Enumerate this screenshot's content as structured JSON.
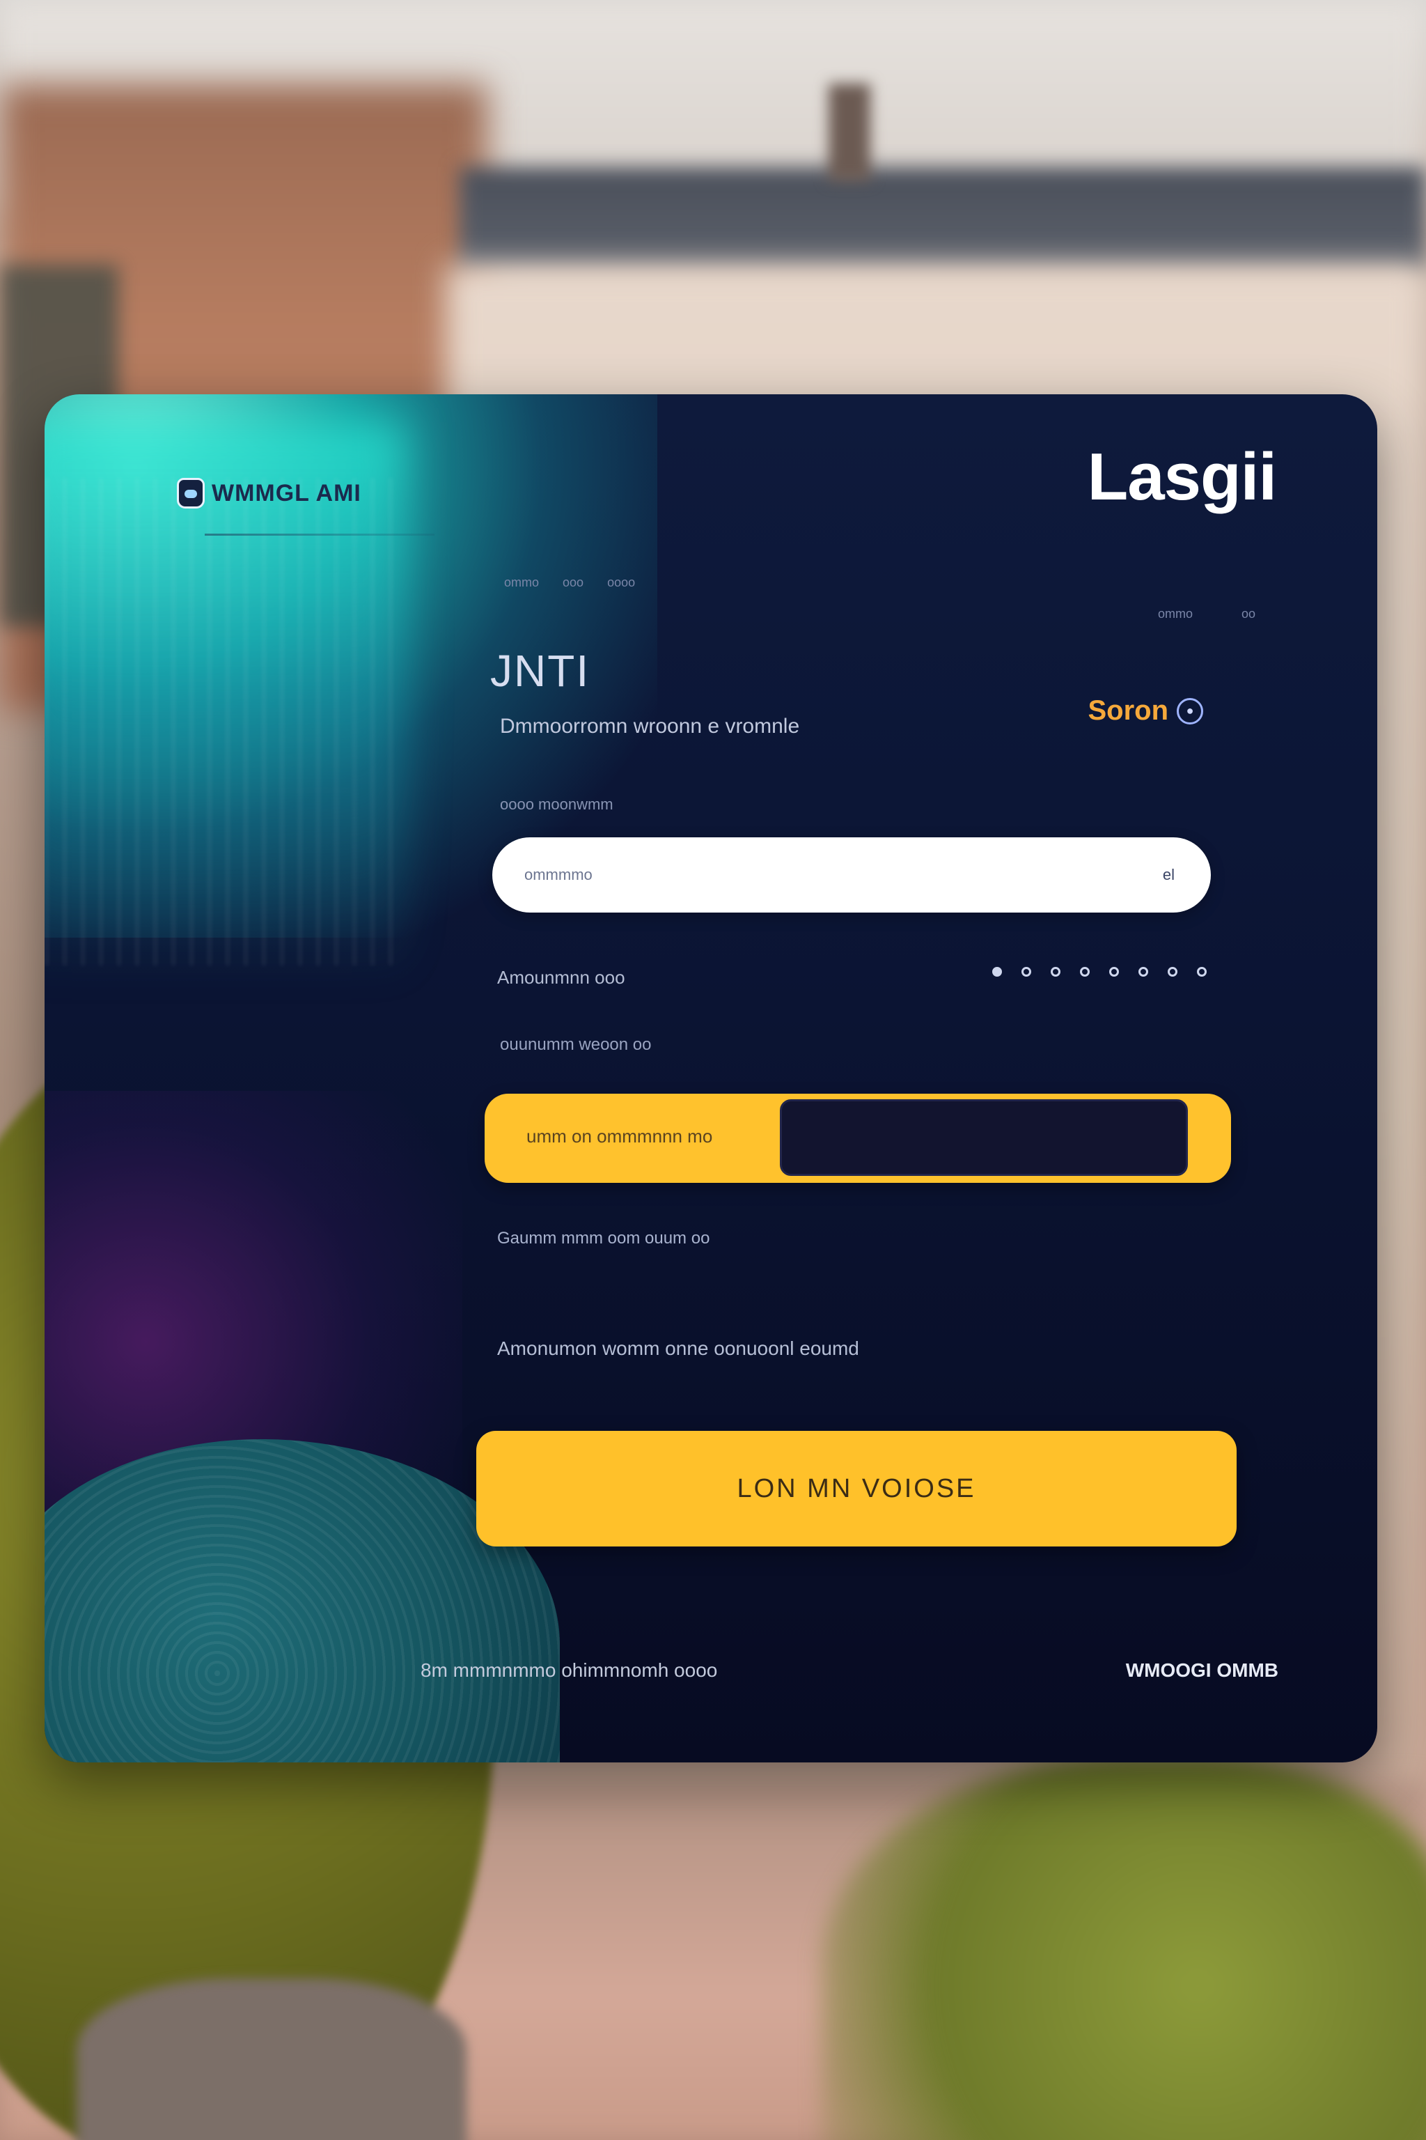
{
  "brand": {
    "name": "WMMGL AMI"
  },
  "header": {
    "title": "Lasgii"
  },
  "nav": {
    "top_items": [
      "ommo",
      "ooo",
      "oooo"
    ],
    "right_items": [
      "ommo",
      "oo"
    ]
  },
  "hero": {
    "headline": "JNTI",
    "subheadline": "Dmmoorromn wroonn e vromnle"
  },
  "status": {
    "label": "Soron",
    "icon": "info-circle-icon"
  },
  "form": {
    "field_label": "oooo moonwmm",
    "input_value": "",
    "input_placeholder": "ommmmo",
    "input_icon_text": "el",
    "row_label": "Amounmnn ooo",
    "dots_count": 8,
    "hint": "ouunumm weoon oo",
    "toggle_label": "umm on ommmnnn mo",
    "link_text": "Gaumm mmm oom ouum oo",
    "terms_text": "Amonumon womm onne oonuoonl eoumd",
    "submit_label": "LON MN VOIOSE"
  },
  "footer": {
    "left_text": "8m mmmnmmo ohimmnomh oooo",
    "right_text": "WMOOGI OMMB"
  },
  "colors": {
    "accent": "#ffc12a",
    "status": "#f6a93b",
    "card": "#0b1433",
    "teal_glow": "#3de6d4"
  }
}
